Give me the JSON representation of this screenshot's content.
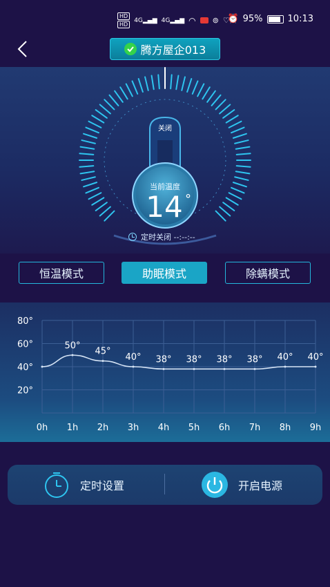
{
  "status_bar": {
    "network_chip_1": "HD",
    "network_chip_2": "HD",
    "signal_1": "4G",
    "signal_2": "4G",
    "battery_percent": "95%",
    "time": "10:13"
  },
  "header": {
    "device_name": "腾方屋企013"
  },
  "dial": {
    "switch_label": "关闭",
    "current_temp_label": "当前温度",
    "current_temp_value": "14",
    "degree_symbol": "°",
    "timer_text": "定时关闭 --:--:--",
    "level": 0.14
  },
  "modes": [
    {
      "label": "恒温模式",
      "active": false
    },
    {
      "label": "助眠模式",
      "active": true
    },
    {
      "label": "除螨模式",
      "active": false
    }
  ],
  "chart_data": {
    "type": "line",
    "categories": [
      "0h",
      "1h",
      "2h",
      "3h",
      "4h",
      "5h",
      "6h",
      "7h",
      "8h",
      "9h"
    ],
    "values": [
      40,
      50,
      45,
      40,
      38,
      38,
      38,
      38,
      40,
      40
    ],
    "data_labels": [
      "",
      "50°",
      "45°",
      "40°",
      "38°",
      "38°",
      "38°",
      "38°",
      "40°",
      "40°"
    ],
    "y_ticks": [
      "20°",
      "40°",
      "60°",
      "80°"
    ],
    "ylim": [
      0,
      80
    ],
    "grid": true,
    "colors": {
      "line": "#d6e4f5",
      "grid": "#3d5f95"
    }
  },
  "controls": {
    "timer_label": "定时设置",
    "power_label": "开启电源"
  },
  "colors": {
    "background": "#1d1247",
    "accent": "#1aa5c6",
    "tick": "#2ec5f0"
  }
}
